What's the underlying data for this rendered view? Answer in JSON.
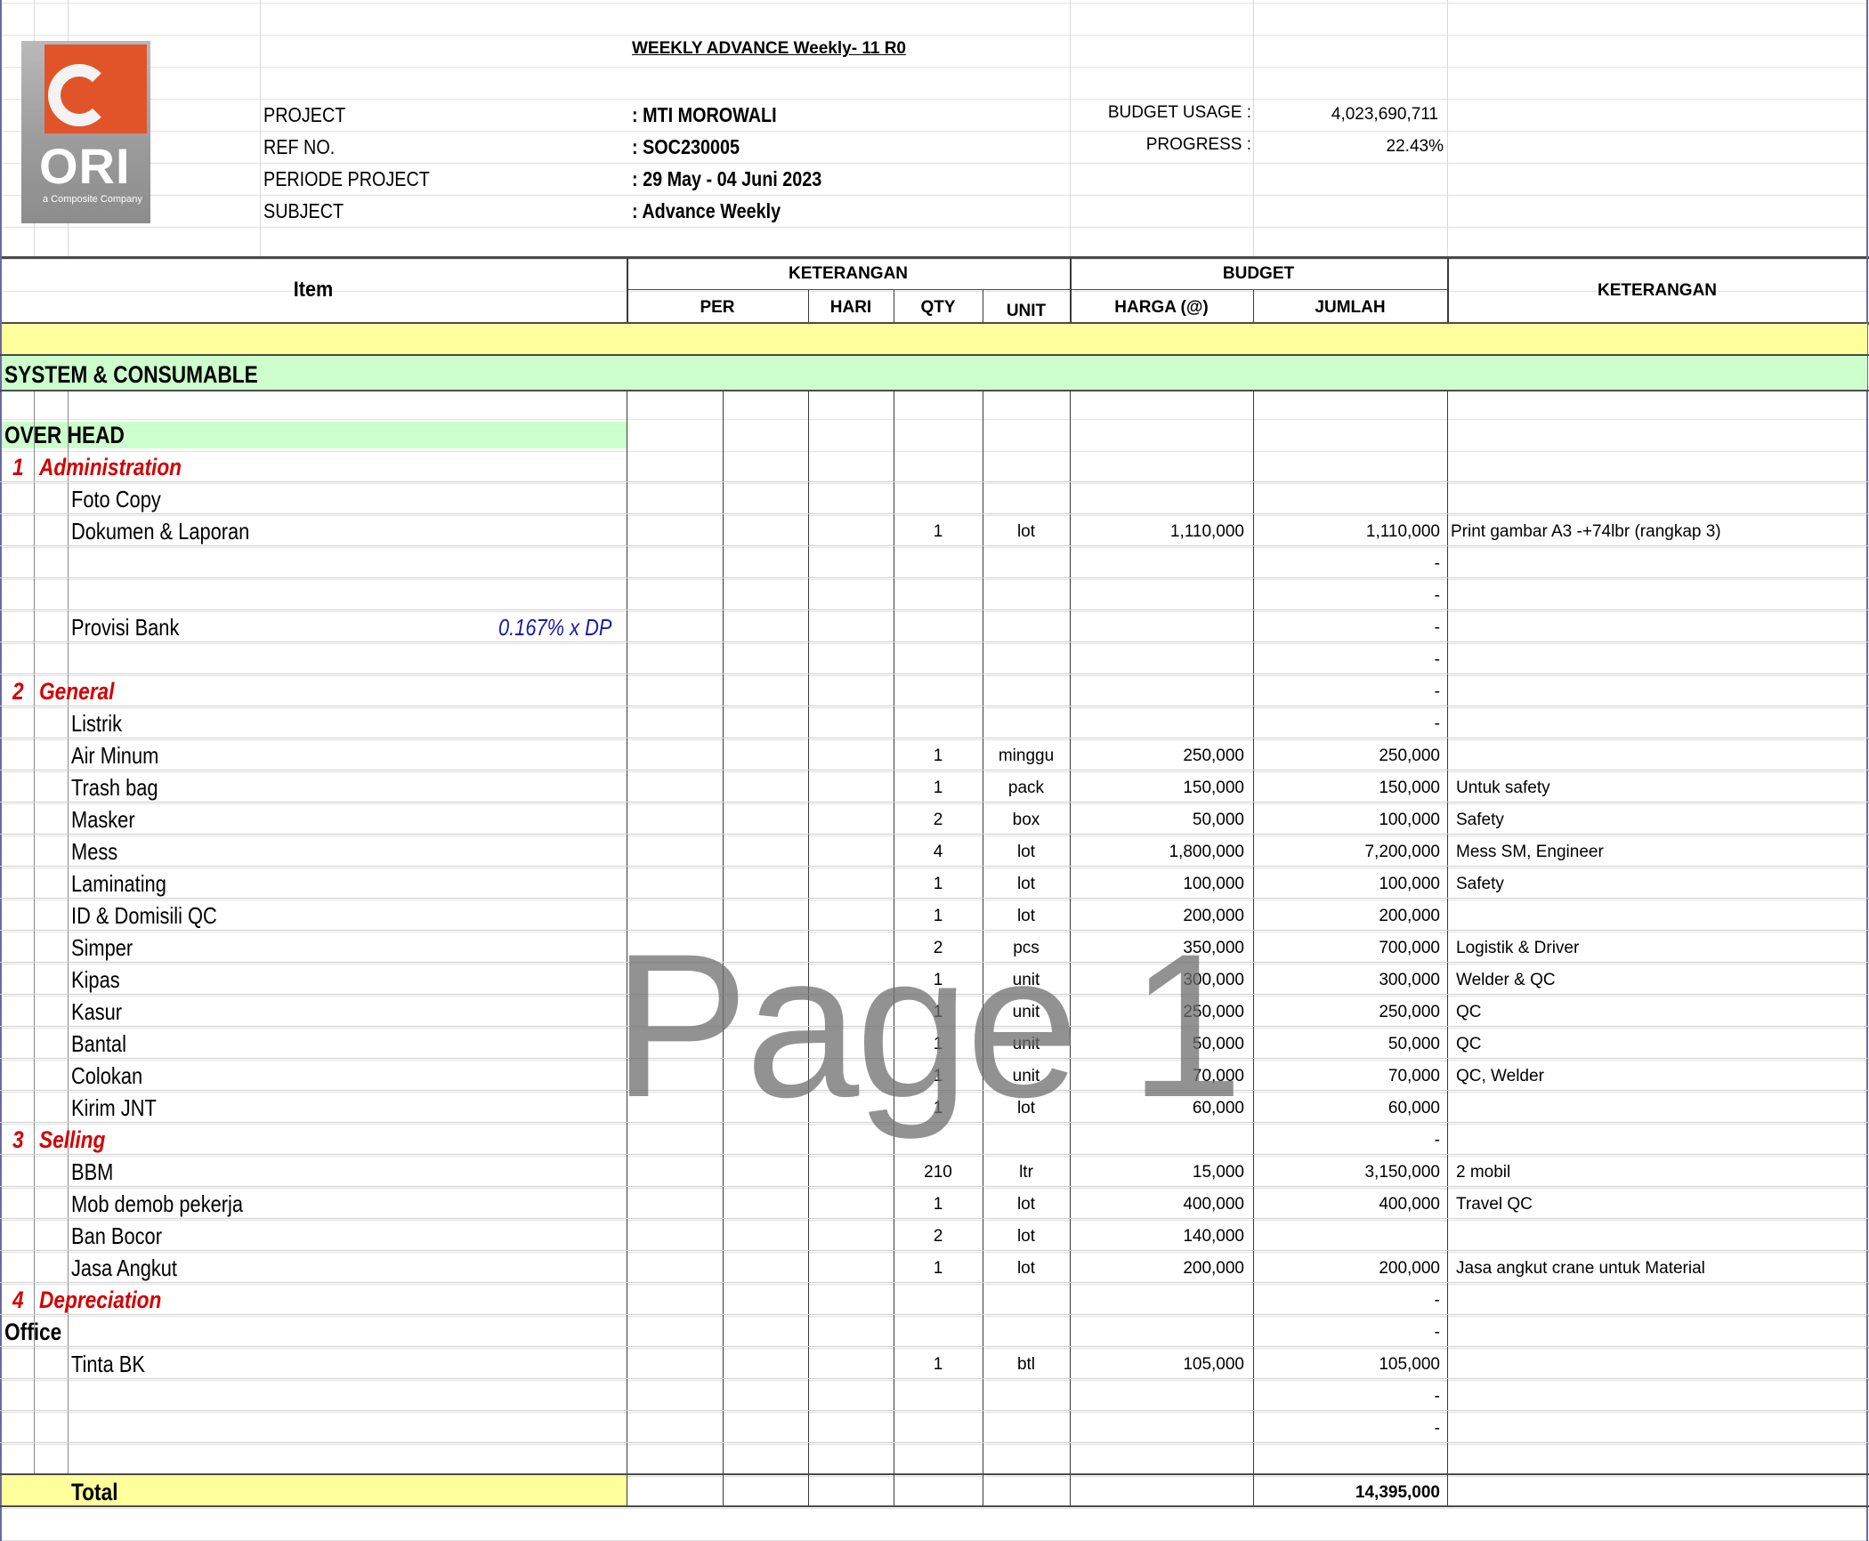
{
  "doc_title": "WEEKLY ADVANCE Weekly- 11 R0",
  "logo": {
    "brand": "ORI",
    "tagline": "a Composite Company"
  },
  "meta": {
    "project_label": "PROJECT",
    "project_value": ": MTI MOROWALI",
    "ref_label": "REF NO.",
    "ref_value": ": SOC230005",
    "periode_label": "PERIODE PROJECT",
    "periode_value": ": 29 May - 04 Juni  2023",
    "subject_label": "SUBJECT",
    "subject_value": ": Advance Weekly",
    "budget_usage_label": "BUDGET USAGE :",
    "budget_usage_value": "4,023,690,711",
    "progress_label": "PROGRESS :",
    "progress_value": "22.43%"
  },
  "table_header": {
    "item": "Item",
    "keterangan_group": "KETERANGAN",
    "budget_group": "BUDGET",
    "per": "PER",
    "hari": "HARI",
    "qty": "QTY",
    "unit": "UNIT",
    "harga": "HARGA (@)",
    "jumlah": "JUMLAH",
    "keterangan": "KETERANGAN"
  },
  "section_title": "SYSTEM & CONSUMABLE",
  "overhead_title": "OVER HEAD",
  "rows": [
    {
      "no": "1",
      "item": "Administration",
      "kind": "cat",
      "note": "",
      "qty": "",
      "unit": "",
      "harga": "",
      "jumlah": "",
      "ket": ""
    },
    {
      "no": "",
      "item": "Foto Copy",
      "kind": "item",
      "note": "",
      "qty": "",
      "unit": "",
      "harga": "",
      "jumlah": "",
      "ket": ""
    },
    {
      "no": "",
      "item": "Dokumen & Laporan",
      "kind": "item",
      "note": "",
      "qty": "1",
      "unit": "lot",
      "harga": "1,110,000",
      "jumlah": "1,110,000",
      "ket": "Print gambar A3 -+74lbr (rangkap 3)"
    },
    {
      "no": "",
      "item": "",
      "kind": "item",
      "note": "",
      "qty": "",
      "unit": "",
      "harga": "",
      "jumlah": "-",
      "ket": ""
    },
    {
      "no": "",
      "item": "",
      "kind": "item",
      "note": "",
      "qty": "",
      "unit": "",
      "harga": "",
      "jumlah": "-",
      "ket": ""
    },
    {
      "no": "",
      "item": "Provisi Bank",
      "kind": "item",
      "note": "0.167% x DP",
      "qty": "",
      "unit": "",
      "harga": "",
      "jumlah": "-",
      "ket": ""
    },
    {
      "no": "",
      "item": "",
      "kind": "item",
      "note": "",
      "qty": "",
      "unit": "",
      "harga": "",
      "jumlah": "-",
      "ket": ""
    },
    {
      "no": "2",
      "item": "General",
      "kind": "cat",
      "note": "",
      "qty": "",
      "unit": "",
      "harga": "",
      "jumlah": "-",
      "ket": ""
    },
    {
      "no": "",
      "item": "Listrik",
      "kind": "item",
      "note": "",
      "qty": "",
      "unit": "",
      "harga": "",
      "jumlah": "-",
      "ket": ""
    },
    {
      "no": "",
      "item": "Air Minum",
      "kind": "item",
      "note": "",
      "qty": "1",
      "unit": "minggu",
      "harga": "250,000",
      "jumlah": "250,000",
      "ket": ""
    },
    {
      "no": "",
      "item": "Trash bag",
      "kind": "item",
      "note": "",
      "qty": "1",
      "unit": "pack",
      "harga": "150,000",
      "jumlah": "150,000",
      "ket": "Untuk safety"
    },
    {
      "no": "",
      "item": "Masker",
      "kind": "item",
      "note": "",
      "qty": "2",
      "unit": "box",
      "harga": "50,000",
      "jumlah": "100,000",
      "ket": "Safety"
    },
    {
      "no": "",
      "item": "Mess",
      "kind": "item",
      "note": "",
      "qty": "4",
      "unit": "lot",
      "harga": "1,800,000",
      "jumlah": "7,200,000",
      "ket": "Mess SM, Engineer"
    },
    {
      "no": "",
      "item": "Laminating",
      "kind": "item",
      "note": "",
      "qty": "1",
      "unit": "lot",
      "harga": "100,000",
      "jumlah": "100,000",
      "ket": "Safety"
    },
    {
      "no": "",
      "item": "ID & Domisili QC",
      "kind": "item",
      "note": "",
      "qty": "1",
      "unit": "lot",
      "harga": "200,000",
      "jumlah": "200,000",
      "ket": ""
    },
    {
      "no": "",
      "item": "Simper",
      "kind": "item",
      "note": "",
      "qty": "2",
      "unit": "pcs",
      "harga": "350,000",
      "jumlah": "700,000",
      "ket": "Logistik & Driver"
    },
    {
      "no": "",
      "item": "Kipas",
      "kind": "item",
      "note": "",
      "qty": "1",
      "unit": "unit",
      "harga": "300,000",
      "jumlah": "300,000",
      "ket": "Welder & QC"
    },
    {
      "no": "",
      "item": "Kasur",
      "kind": "item",
      "note": "",
      "qty": "1",
      "unit": "unit",
      "harga": "250,000",
      "jumlah": "250,000",
      "ket": "QC"
    },
    {
      "no": "",
      "item": "Bantal",
      "kind": "item",
      "note": "",
      "qty": "1",
      "unit": "unit",
      "harga": "50,000",
      "jumlah": "50,000",
      "ket": "QC"
    },
    {
      "no": "",
      "item": "Colokan",
      "kind": "item",
      "note": "",
      "qty": "1",
      "unit": "unit",
      "harga": "70,000",
      "jumlah": "70,000",
      "ket": "QC, Welder"
    },
    {
      "no": "",
      "item": "Kirim JNT",
      "kind": "item",
      "note": "",
      "qty": "1",
      "unit": "lot",
      "harga": "60,000",
      "jumlah": "60,000",
      "ket": ""
    },
    {
      "no": "3",
      "item": "Selling",
      "kind": "cat",
      "note": "",
      "qty": "",
      "unit": "",
      "harga": "",
      "jumlah": "-",
      "ket": ""
    },
    {
      "no": "",
      "item": "BBM",
      "kind": "item",
      "note": "",
      "qty": "210",
      "unit": "ltr",
      "harga": "15,000",
      "jumlah": "3,150,000",
      "ket": "2 mobil"
    },
    {
      "no": "",
      "item": "Mob demob pekerja",
      "kind": "item",
      "note": "",
      "qty": "1",
      "unit": "lot",
      "harga": "400,000",
      "jumlah": "400,000",
      "ket": "Travel QC"
    },
    {
      "no": "",
      "item": "Ban Bocor",
      "kind": "item",
      "note": "",
      "qty": "2",
      "unit": "lot",
      "harga": "140,000",
      "jumlah": "",
      "ket": ""
    },
    {
      "no": "",
      "item": "Jasa Angkut",
      "kind": "item",
      "note": "",
      "qty": "1",
      "unit": "lot",
      "harga": "200,000",
      "jumlah": "200,000",
      "ket": "Jasa angkut crane untuk Material"
    },
    {
      "no": "4",
      "item": "Depreciation",
      "kind": "cat",
      "note": "",
      "qty": "",
      "unit": "",
      "harga": "",
      "jumlah": "-",
      "ket": ""
    },
    {
      "no": "",
      "item": "Office",
      "kind": "sub",
      "note": "",
      "qty": "",
      "unit": "",
      "harga": "",
      "jumlah": "-",
      "ket": ""
    },
    {
      "no": "",
      "item": "Tinta BK",
      "kind": "item",
      "note": "",
      "qty": "1",
      "unit": "btl",
      "harga": "105,000",
      "jumlah": "105,000",
      "ket": ""
    },
    {
      "no": "",
      "item": "",
      "kind": "item",
      "note": "",
      "qty": "",
      "unit": "",
      "harga": "",
      "jumlah": "-",
      "ket": ""
    },
    {
      "no": "",
      "item": "",
      "kind": "item",
      "note": "",
      "qty": "",
      "unit": "",
      "harga": "",
      "jumlah": "-",
      "ket": ""
    }
  ],
  "total": {
    "label": "Total",
    "value": "14,395,000"
  },
  "watermark": "Page 1"
}
